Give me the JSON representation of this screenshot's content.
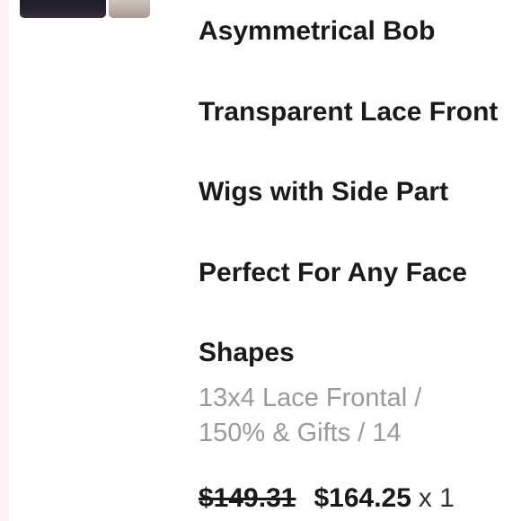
{
  "product": {
    "title_lines": [
      "Asymmetrical Bob",
      "Transparent Lace Front",
      "Wigs with Side Part",
      "Perfect For Any Face",
      "Shapes"
    ],
    "variant_lines": [
      "13x4 Lace Frontal /",
      "150% & Gifts / 14"
    ],
    "original_price": "$149.31",
    "price": "$164.25",
    "quantity": "x 1"
  },
  "colors": {
    "text": "#1a1a1a",
    "muted": "#9a9a9a",
    "sidebar_tint": "#fdf2f4"
  }
}
